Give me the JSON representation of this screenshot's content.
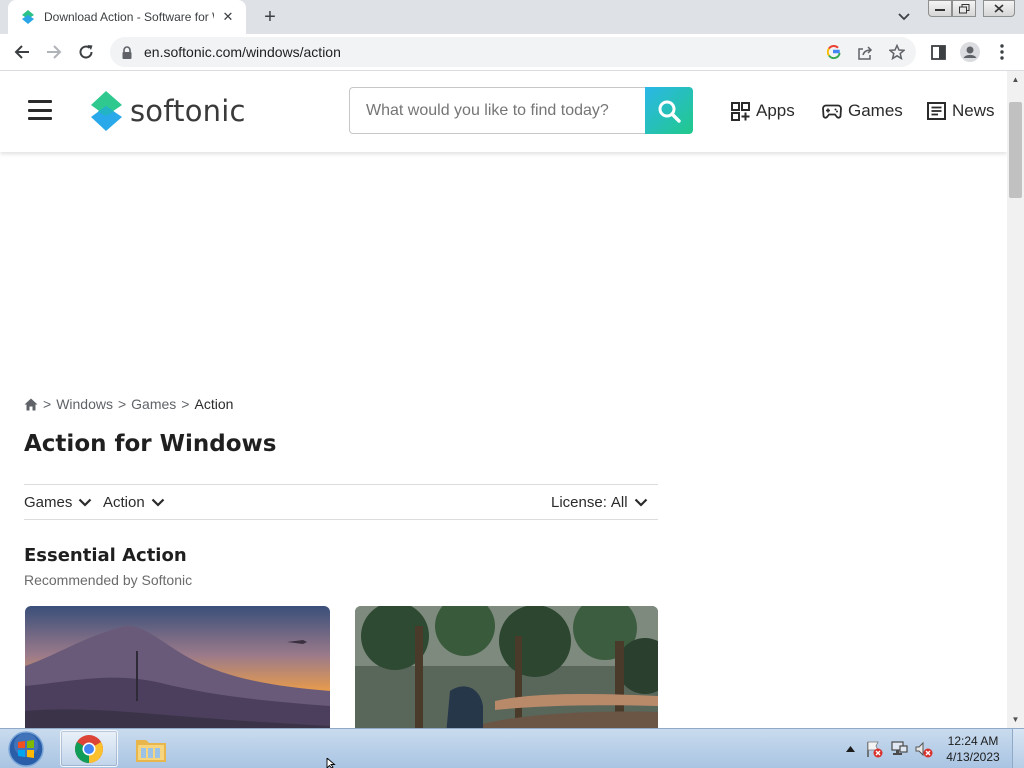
{
  "browser": {
    "tab": {
      "title": "Download Action - Software for Windows",
      "favicon": "softonic-logo-icon"
    },
    "url": "en.softonic.com/windows/action",
    "colors": {
      "tabstrip": "#dee1e6",
      "toolbar": "#ffffff",
      "omnibox": "#f1f3f4"
    }
  },
  "site": {
    "logo_text": "softonic",
    "search_placeholder": "What would you like to find today?",
    "nav": [
      {
        "label": "Apps",
        "icon": "apps-grid-icon"
      },
      {
        "label": "Games",
        "icon": "gamepad-icon"
      },
      {
        "label": "News",
        "icon": "news-icon"
      }
    ],
    "colors": {
      "brand_blue": "#2bb7e8",
      "brand_green": "#21c98a"
    }
  },
  "breadcrumb": {
    "home_icon": "home-icon",
    "items": [
      "Windows",
      "Games",
      "Action"
    ],
    "separator": ">"
  },
  "page": {
    "title": "Action for Windows",
    "filters": {
      "category": "Games",
      "subcategory": "Action",
      "license_label": "License:",
      "license_value": "All"
    },
    "section": {
      "title": "Essential Action",
      "subtitle": "Recommended by Softonic"
    }
  },
  "taskbar": {
    "time": "12:24 AM",
    "date": "4/13/2023",
    "pinned": [
      "chrome-icon",
      "file-explorer-icon"
    ]
  }
}
